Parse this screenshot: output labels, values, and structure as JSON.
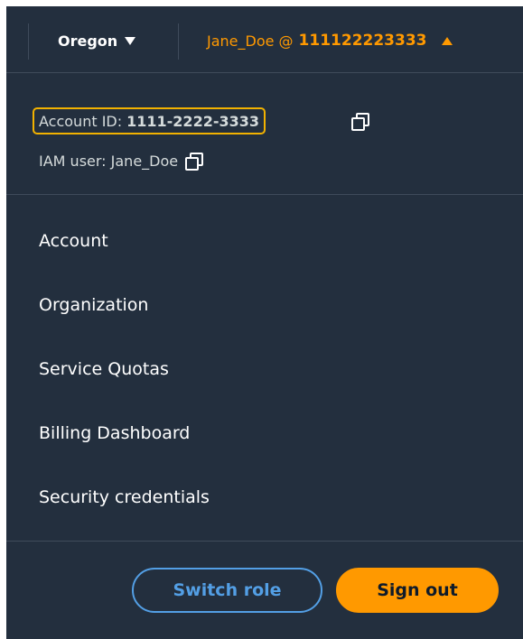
{
  "header": {
    "region": "Oregon",
    "user_name": "Jane_Doe @",
    "account_number": "111122223333"
  },
  "account_info": {
    "account_id_label": "Account ID:",
    "account_id_value": "1111-2222-3333",
    "iam_user": "IAM user: Jane_Doe"
  },
  "menu": {
    "items": [
      {
        "label": "Account"
      },
      {
        "label": "Organization"
      },
      {
        "label": "Service Quotas"
      },
      {
        "label": "Billing Dashboard"
      },
      {
        "label": "Security credentials"
      }
    ]
  },
  "actions": {
    "switch_role": "Switch role",
    "sign_out": "Sign out"
  },
  "colors": {
    "background": "#232f3e",
    "accent": "#ff9900",
    "link_blue": "#539fe5",
    "highlight_border": "#f2b200"
  }
}
